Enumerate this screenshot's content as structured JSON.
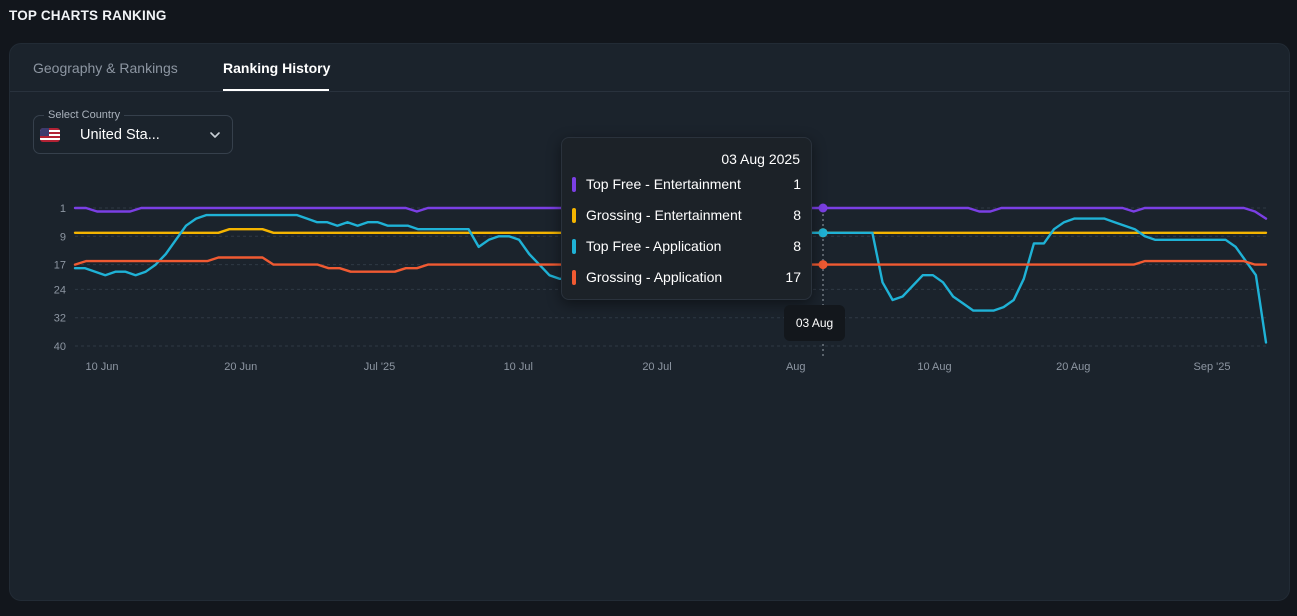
{
  "page": {
    "title": "TOP CHARTS RANKING"
  },
  "tabs": [
    {
      "label": "Geography & Rankings",
      "active": false
    },
    {
      "label": "Ranking History",
      "active": true
    }
  ],
  "country_select": {
    "label": "Select Country",
    "value": "United Sta...",
    "flag_icon": "us-flag-icon"
  },
  "tooltip": {
    "date": "03 Aug 2025",
    "rows": [
      {
        "name": "Top Free - Entertainment",
        "value": "1",
        "color": "#7b3fe4"
      },
      {
        "name": "Grossing - Entertainment",
        "value": "8",
        "color": "#f4b400"
      },
      {
        "name": "Top Free - Application",
        "value": "8",
        "color": "#1fb2d6"
      },
      {
        "name": "Grossing - Application",
        "value": "17",
        "color": "#f05a32"
      }
    ]
  },
  "crosshair": {
    "label": "03 Aug"
  },
  "chart_data": {
    "type": "line",
    "y_axis": {
      "ticks": [
        1,
        9,
        17,
        24,
        32,
        40
      ],
      "reversed": true,
      "range": [
        1,
        40
      ]
    },
    "x_axis": {
      "ticks": [
        "10 Jun",
        "20 Jun",
        "Jul '25",
        "10 Jul",
        "20 Jul",
        "Aug",
        "10 Aug",
        "20 Aug",
        "Sep '25"
      ]
    },
    "grid": "horizontal-dashed",
    "series": [
      {
        "name": "Top Free - Entertainment",
        "color": "#7b3fe4",
        "values": [
          1,
          1,
          2,
          2,
          2,
          2,
          1,
          1,
          1,
          1,
          1,
          1,
          1,
          1,
          1,
          1,
          1,
          1,
          1,
          1,
          1,
          1,
          1,
          1,
          1,
          1,
          1,
          1,
          1,
          1,
          1,
          2,
          1,
          1,
          1,
          1,
          1,
          1,
          1,
          1,
          1,
          1,
          1,
          1,
          1,
          1,
          1,
          1,
          1,
          1,
          1,
          1,
          1,
          1,
          1,
          1,
          1,
          1,
          1,
          1,
          1,
          1,
          1,
          1,
          1,
          1,
          1,
          1,
          1,
          1,
          1,
          1,
          1,
          1,
          1,
          1,
          1,
          1,
          1,
          1,
          1,
          1,
          2,
          2,
          1,
          1,
          1,
          1,
          1,
          1,
          1,
          1,
          1,
          1,
          1,
          1,
          2,
          1,
          1,
          1,
          1,
          1,
          1,
          1,
          1,
          1,
          1,
          2,
          4
        ]
      },
      {
        "name": "Grossing - Entertainment",
        "color": "#f4b400",
        "values": [
          8,
          8,
          8,
          8,
          8,
          8,
          8,
          8,
          8,
          8,
          8,
          8,
          8,
          8,
          7,
          7,
          7,
          7,
          8,
          8,
          8,
          8,
          8,
          8,
          8,
          8,
          8,
          8,
          8,
          8,
          8,
          8,
          8,
          8,
          8,
          8,
          8,
          8,
          8,
          8,
          8,
          8,
          8,
          8,
          8,
          8,
          8,
          8,
          8,
          8,
          8,
          8,
          8,
          8,
          8,
          8,
          8,
          8,
          8,
          8,
          8,
          8,
          8,
          8,
          8,
          8,
          8,
          8,
          8,
          8,
          8,
          8,
          8,
          8,
          8,
          8,
          8,
          8,
          8,
          8,
          8,
          8,
          8,
          8,
          8,
          8,
          8,
          8,
          8,
          8,
          8,
          8,
          8,
          8,
          8,
          8,
          8,
          8,
          8,
          8,
          8,
          8,
          8,
          8,
          8,
          8,
          8,
          8,
          8
        ]
      },
      {
        "name": "Top Free - Application",
        "color": "#1fb2d6",
        "values": [
          18,
          18,
          19,
          20,
          19,
          19,
          20,
          19,
          17,
          14,
          10,
          6,
          4,
          3,
          3,
          3,
          3,
          3,
          3,
          3,
          3,
          3,
          3,
          4,
          5,
          5,
          6,
          5,
          6,
          5,
          5,
          6,
          6,
          6,
          7,
          7,
          7,
          7,
          7,
          7,
          12,
          10,
          9,
          9,
          10,
          14,
          17,
          20,
          21,
          21,
          23,
          19,
          19,
          16,
          12,
          10,
          8,
          8,
          8,
          8,
          8,
          8,
          8,
          8,
          8,
          8,
          8,
          8,
          8,
          8,
          8,
          8,
          8,
          8,
          8,
          8,
          8,
          8,
          8,
          8,
          22,
          27,
          26,
          23,
          20,
          20,
          22,
          26,
          28,
          30,
          30,
          30,
          29,
          27,
          21,
          11,
          11,
          7,
          5,
          4,
          4,
          4,
          4,
          5,
          6,
          7,
          9,
          10,
          10,
          10,
          10,
          10,
          10,
          10,
          10,
          12,
          16,
          20,
          39
        ]
      },
      {
        "name": "Grossing - Application",
        "color": "#f05a32",
        "values": [
          17,
          16,
          16,
          16,
          16,
          16,
          16,
          16,
          16,
          16,
          16,
          16,
          16,
          15,
          15,
          15,
          15,
          15,
          17,
          17,
          17,
          17,
          17,
          18,
          18,
          19,
          19,
          19,
          19,
          19,
          18,
          18,
          17,
          17,
          17,
          17,
          17,
          17,
          17,
          17,
          17,
          17,
          17,
          17,
          17,
          17,
          17,
          17,
          17,
          17,
          17,
          17,
          17,
          17,
          17,
          17,
          17,
          17,
          17,
          17,
          17,
          17,
          17,
          17,
          17,
          17,
          17,
          17,
          17,
          17,
          17,
          17,
          17,
          17,
          17,
          17,
          17,
          17,
          17,
          17,
          17,
          17,
          17,
          17,
          17,
          17,
          17,
          17,
          17,
          17,
          17,
          17,
          17,
          17,
          17,
          17,
          17,
          16,
          16,
          16,
          16,
          16,
          16,
          16,
          16,
          16,
          16,
          17,
          17
        ]
      }
    ],
    "highlight": {
      "label": "03 Aug",
      "values": {
        "Top Free - Entertainment": 1,
        "Grossing - Entertainment": 8,
        "Top Free - Application": 8,
        "Grossing - Application": 17
      }
    }
  }
}
